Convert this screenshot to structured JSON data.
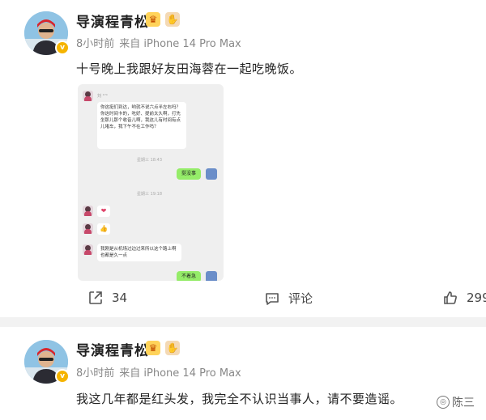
{
  "posts": [
    {
      "author": "导演程青松",
      "time_ago": "8小时前",
      "source": "来自 iPhone 14 Pro Max",
      "text": "十号晚上我跟好友田海蓉在一起吃晚饭。",
      "actions": {
        "share_count": "34",
        "comment_label": "评论",
        "like_count": "299"
      }
    },
    {
      "author": "导演程青松",
      "time_ago": "8小时前",
      "source": "来自 iPhone 14 Pro Max",
      "text": "我这几年都是红头发，我完全不认识当事人，请不要造谣。"
    }
  ],
  "chat": {
    "contact_name": "刘 ¹⁷⁰",
    "msg1": "你这挺们到达，哟就不说六点半左右吗？你这时间卡的，吃好、提前太久啊，打先坐那儿那个收音儿啊，我这儿有时间有点儿堵车，我下午不在工作吗？",
    "time1": "星期三 18:43",
    "reply1": "挺没事",
    "time2": "星期三 19:18",
    "emoji1": "❤",
    "emoji2": "👍",
    "msg2": "我刚是从机场过边过来所以这个路上啊也都是久一点",
    "reply2": "不着急"
  },
  "watermark": "陈三",
  "colors": {
    "accent_badge": "#f5b400",
    "chat_green": "#95ec69",
    "divider": "#f2f2f2"
  },
  "icons": [
    "share-icon",
    "comment-icon",
    "like-icon",
    "verified-icon",
    "crown-badge-icon",
    "hand-badge-icon"
  ]
}
